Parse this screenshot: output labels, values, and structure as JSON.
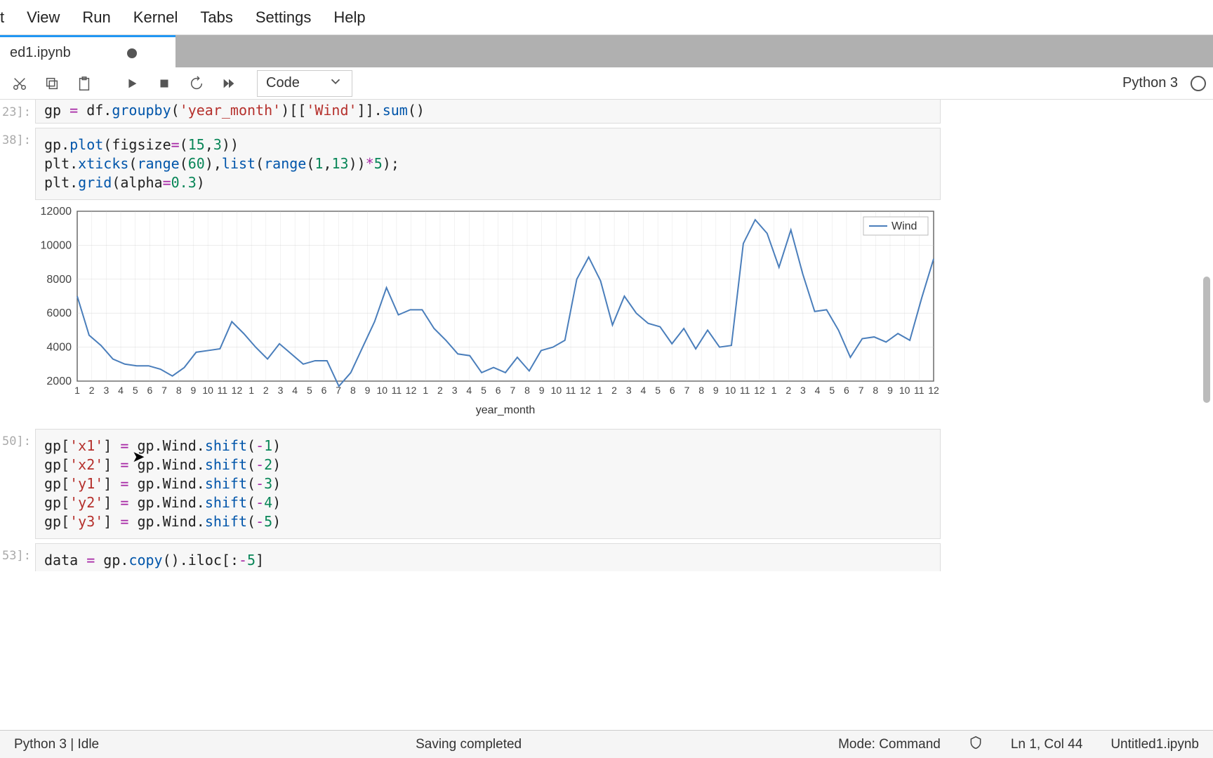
{
  "menu": [
    "t",
    "View",
    "Run",
    "Kernel",
    "Tabs",
    "Settings",
    "Help"
  ],
  "tab": {
    "title": "ed1.ipynb"
  },
  "toolbar": {
    "celltype": "Code",
    "kernel": "Python 3"
  },
  "prompts": {
    "c1": "23]:",
    "c2": "38]:",
    "c3": "50]:",
    "c4": "53]:"
  },
  "code1": "gp = df.groupby('year_month')[['Wind']].sum()",
  "code2_l1": "gp.plot(figsize=(15,3))",
  "code2_l2": "plt.xticks(range(60),list(range(1,13))*5);",
  "code2_l3": "plt.grid(alpha=0.3)",
  "code3_l1": "gp['x1'] = gp.Wind.shift(-1)",
  "code3_l2": "gp['x2'] = gp.Wind.shift(-2)",
  "code3_l3": "gp['y1'] = gp.Wind.shift(-3)",
  "code3_l4": "gp['y2'] = gp.Wind.shift(-4)",
  "code3_l5": "gp['y3'] = gp.Wind.shift(-5)",
  "code4": "data = gp.copy().iloc[:-5]",
  "status": {
    "kernel": "Python 3 | Idle",
    "save": "Saving completed",
    "mode": "Mode: Command",
    "cursor": "Ln 1, Col 44",
    "file": "Untitled1.ipynb"
  },
  "chart_data": {
    "type": "line",
    "title": "",
    "xlabel": "year_month",
    "ylabel": "",
    "legend": [
      "Wind"
    ],
    "ylim": [
      2000,
      12000
    ],
    "yticks": [
      2000,
      4000,
      6000,
      8000,
      10000,
      12000
    ],
    "xticks": [
      1,
      2,
      3,
      4,
      5,
      6,
      7,
      8,
      9,
      10,
      11,
      12,
      1,
      2,
      3,
      4,
      5,
      6,
      7,
      8,
      9,
      10,
      11,
      12,
      1,
      2,
      3,
      4,
      5,
      6,
      7,
      8,
      9,
      10,
      11,
      12,
      1,
      2,
      3,
      4,
      5,
      6,
      7,
      8,
      9,
      10,
      11,
      12,
      1,
      2,
      3,
      4,
      5,
      6,
      7,
      8,
      9,
      10,
      11,
      12
    ],
    "values": [
      7000,
      4700,
      4100,
      3300,
      3000,
      2900,
      2900,
      2700,
      2300,
      2800,
      3700,
      3800,
      3900,
      5500,
      4800,
      4000,
      3300,
      4200,
      3600,
      3000,
      3200,
      3200,
      1700,
      2500,
      4000,
      5500,
      7500,
      5900,
      6200,
      6200,
      5100,
      4400,
      3600,
      3500,
      2500,
      2800,
      2500,
      3400,
      2600,
      3800,
      4000,
      4400,
      8000,
      9300,
      7900,
      5300,
      7000,
      6000,
      5400,
      5200,
      4200,
      5100,
      3900,
      5000,
      4000,
      4100,
      10100,
      11500,
      10700,
      8700,
      10900,
      8300,
      6100,
      6200,
      5000,
      3400,
      4500,
      4600,
      4300,
      4800,
      4400,
      6900,
      9200
    ]
  }
}
